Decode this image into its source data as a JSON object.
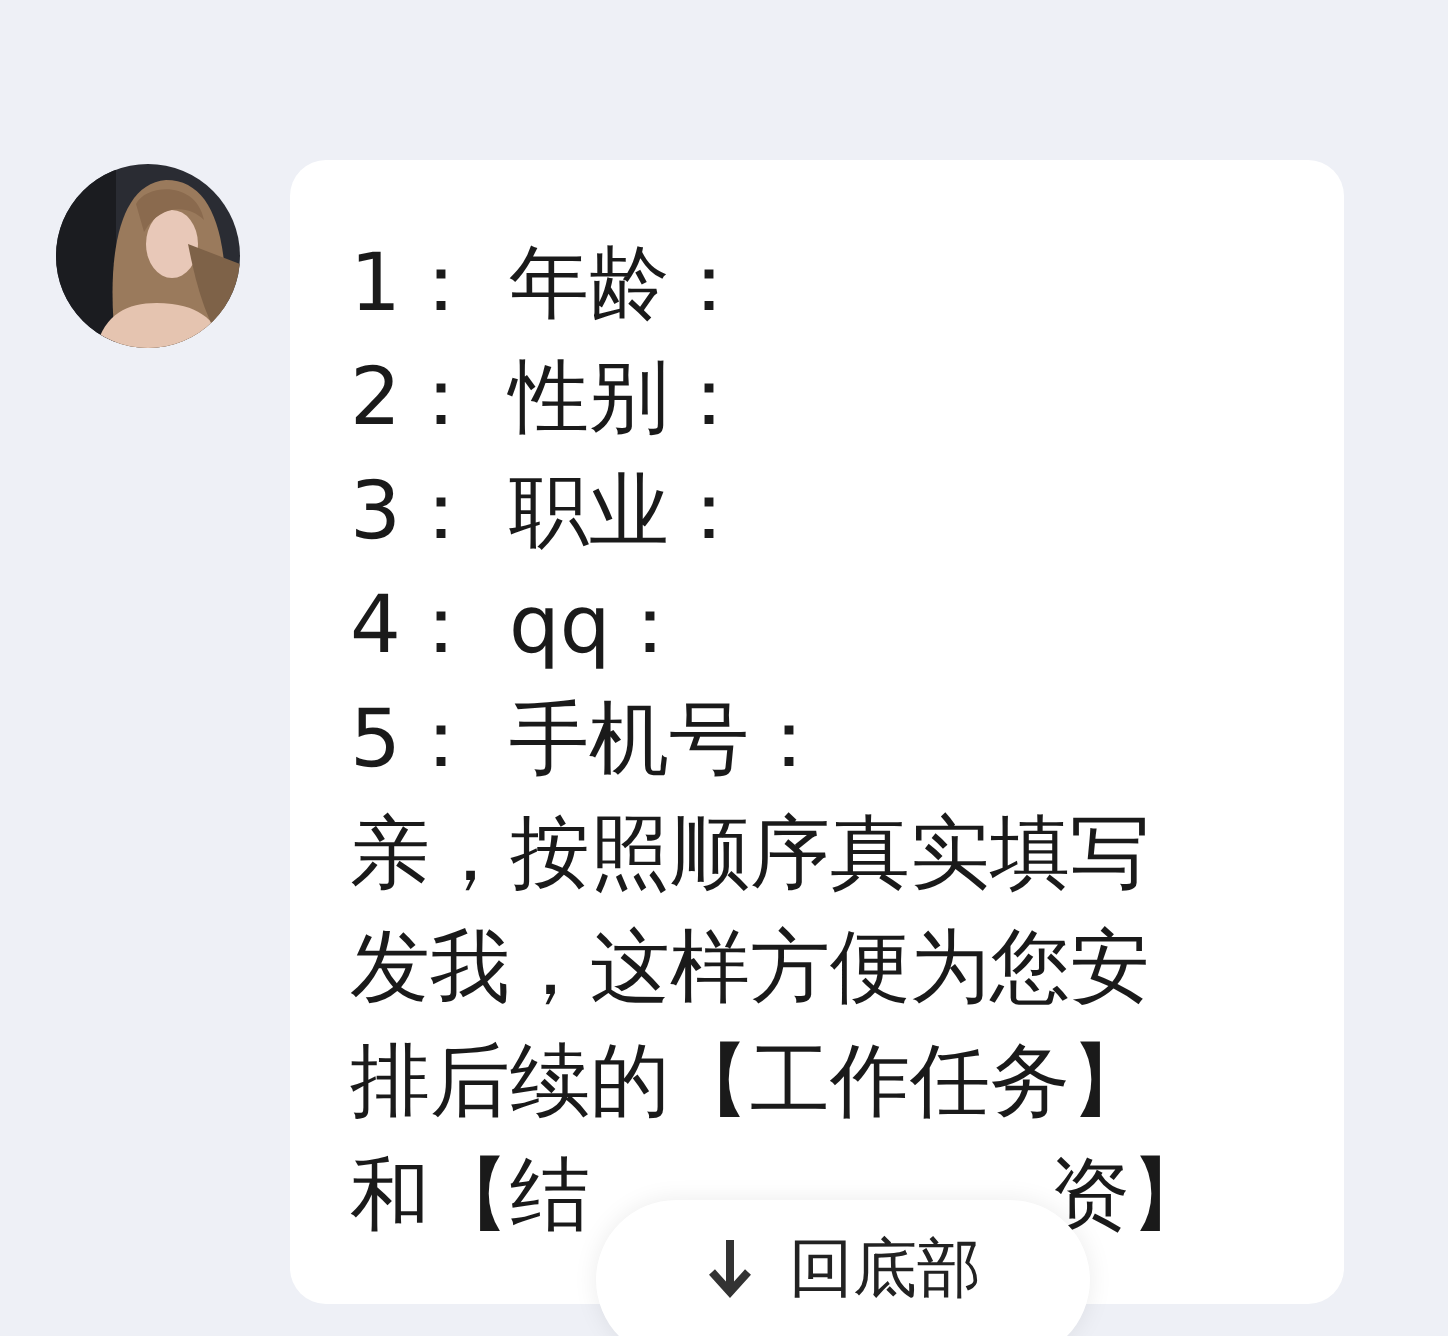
{
  "message": {
    "items": [
      {
        "number": "1：",
        "label": "年龄："
      },
      {
        "number": "2：",
        "label": "性别："
      },
      {
        "number": "3：",
        "label": "职业："
      },
      {
        "number": "4：",
        "label": "qq："
      },
      {
        "number": "5：",
        "label": "手机号："
      }
    ],
    "lines": [
      "亲，按照顺序真实填写",
      "发我，这样方便为您安",
      "排后续的【工作任务】"
    ],
    "last_line_start": "和【结",
    "last_line_end": "资】"
  },
  "scroll_button": {
    "label": "回底部"
  }
}
